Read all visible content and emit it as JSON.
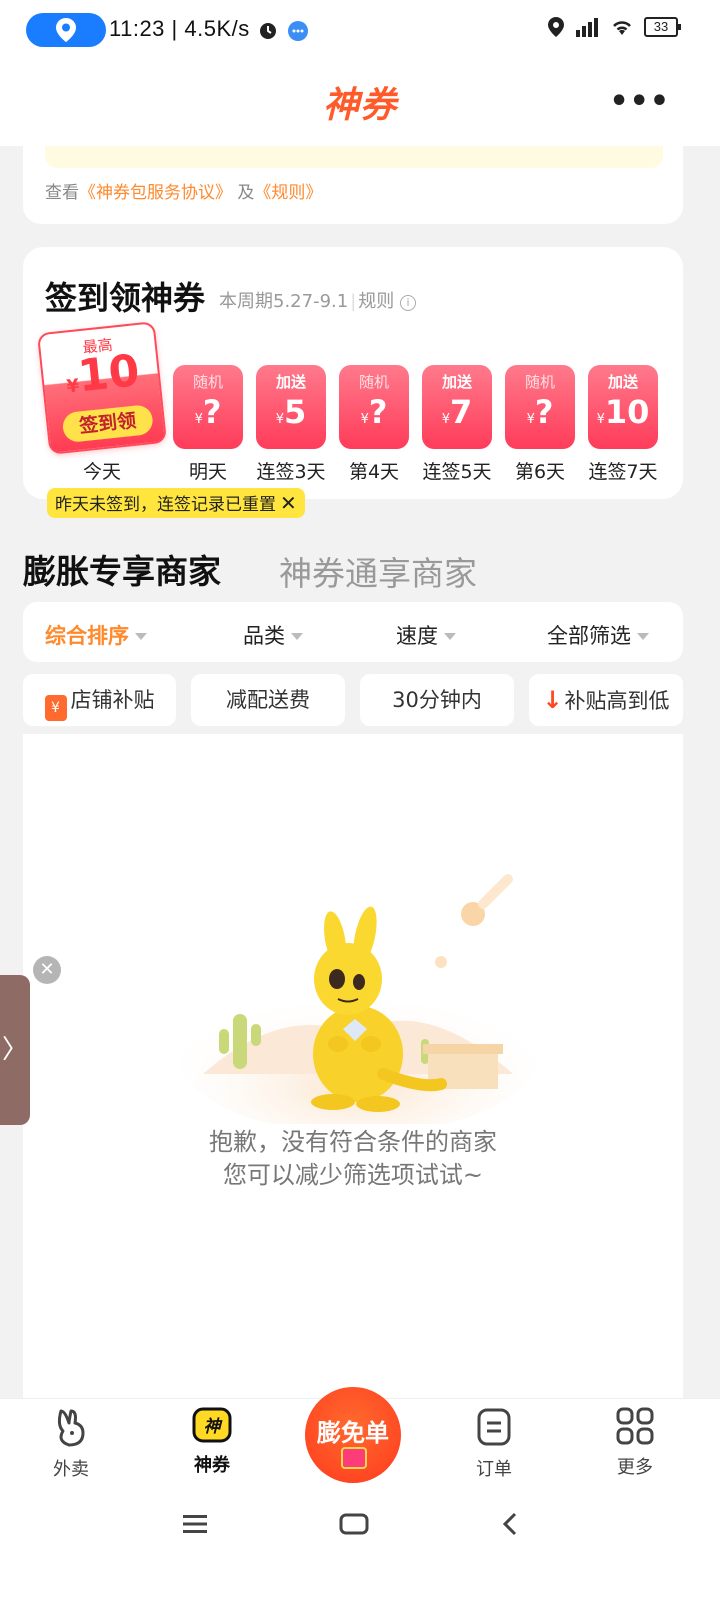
{
  "status_bar": {
    "time_speed": "11:23 | 4.5K/s",
    "battery": "33"
  },
  "header": {
    "title": "神券",
    "more": "•••"
  },
  "top_card": {
    "agree_prefix": "查看",
    "agreement_link": "《神券包服务协议》",
    "and": "及",
    "rules_link": "《规则》"
  },
  "sign_in": {
    "title": "签到领神券",
    "period": "本周期5.27-9.1",
    "rules": "规则",
    "today": {
      "top": "最高",
      "currency": "¥",
      "amount": "10",
      "button": "签到领",
      "label": "今天"
    },
    "days": [
      {
        "tag": "随机",
        "currency": "¥",
        "value": "?",
        "label": "明天"
      },
      {
        "tag": "加送",
        "currency": "¥",
        "value": "5",
        "label": "连签3天"
      },
      {
        "tag": "随机",
        "currency": "¥",
        "value": "?",
        "label": "第4天"
      },
      {
        "tag": "加送",
        "currency": "¥",
        "value": "7",
        "label": "连签5天"
      },
      {
        "tag": "随机",
        "currency": "¥",
        "value": "?",
        "label": "第6天"
      },
      {
        "tag": "加送",
        "currency": "¥",
        "value": "10",
        "label": "连签7天"
      }
    ],
    "reset_tip": "昨天未签到，连签记录已重置"
  },
  "merchant_tabs": {
    "active": "膨胀专享商家",
    "inactive": "神券通享商家"
  },
  "sort_bar": {
    "items": [
      "综合排序",
      "品类",
      "速度",
      "全部筛选"
    ]
  },
  "chips": {
    "items": [
      "店铺补贴",
      "减配送费",
      "30分钟内",
      "补贴高到低"
    ]
  },
  "empty_state": {
    "line1": "抱歉，没有符合条件的商家",
    "line2": "您可以减少筛选项试试~"
  },
  "side_float": {
    "arrow": "〉",
    "close": "✕"
  },
  "bottom_nav": {
    "items": [
      {
        "label": "外卖",
        "icon": "rabbit-icon"
      },
      {
        "label": "神券",
        "icon": "coupon-icon"
      },
      {
        "label": "膨免单",
        "icon": "gift-icon"
      },
      {
        "label": "订单",
        "icon": "order-icon"
      },
      {
        "label": "更多",
        "icon": "grid-icon"
      }
    ]
  },
  "colors": {
    "accent": "#ff5a2a",
    "active_sort": "#ff8a2e",
    "coupon_red": "#ff3c5a",
    "tip_yellow": "#ffe53d"
  }
}
